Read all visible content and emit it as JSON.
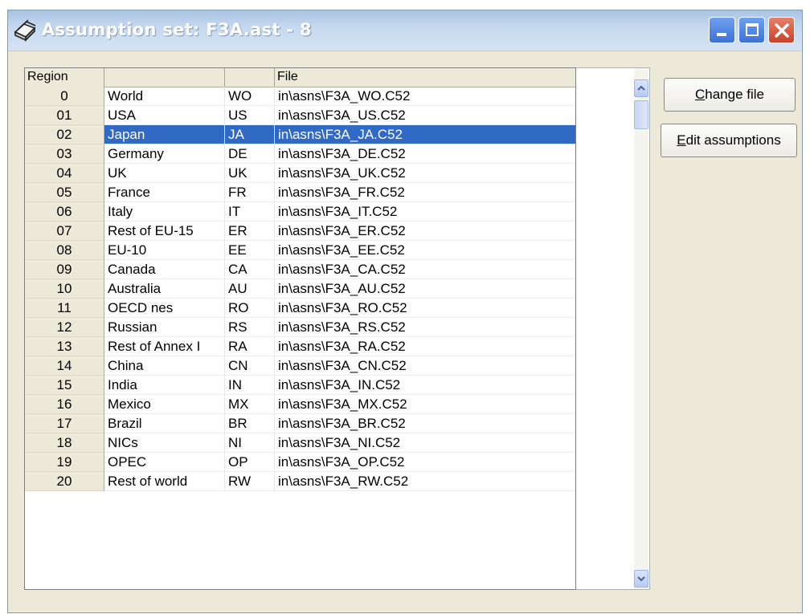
{
  "window": {
    "title": "Assumption set: F3A.ast - 8",
    "icons": {
      "app": "books-icon",
      "minimize": "minimize-icon",
      "maximize": "maximize-icon",
      "close": "close-icon"
    }
  },
  "table": {
    "headers": {
      "region": "Region",
      "name": "",
      "code": "",
      "file": "File"
    },
    "rows": [
      {
        "region": "0",
        "name": "World",
        "code": "WO",
        "file": "in\\asns\\F3A_WO.C52"
      },
      {
        "region": "01",
        "name": "USA",
        "code": "US",
        "file": "in\\asns\\F3A_US.C52"
      },
      {
        "region": "02",
        "name": "Japan",
        "code": "JA",
        "file": "in\\asns\\F3A_JA.C52"
      },
      {
        "region": "03",
        "name": "Germany",
        "code": "DE",
        "file": "in\\asns\\F3A_DE.C52"
      },
      {
        "region": "04",
        "name": "UK",
        "code": "UK",
        "file": "in\\asns\\F3A_UK.C52"
      },
      {
        "region": "05",
        "name": "France",
        "code": "FR",
        "file": "in\\asns\\F3A_FR.C52"
      },
      {
        "region": "06",
        "name": "Italy",
        "code": "IT",
        "file": "in\\asns\\F3A_IT.C52"
      },
      {
        "region": "07",
        "name": "Rest of EU-15",
        "code": "ER",
        "file": "in\\asns\\F3A_ER.C52"
      },
      {
        "region": "08",
        "name": "EU-10",
        "code": "EE",
        "file": "in\\asns\\F3A_EE.C52"
      },
      {
        "region": "09",
        "name": "Canada",
        "code": "CA",
        "file": "in\\asns\\F3A_CA.C52"
      },
      {
        "region": "10",
        "name": "Australia",
        "code": "AU",
        "file": "in\\asns\\F3A_AU.C52"
      },
      {
        "region": "11",
        "name": "OECD nes",
        "code": "RO",
        "file": "in\\asns\\F3A_RO.C52"
      },
      {
        "region": "12",
        "name": "Russian",
        "code": "RS",
        "file": "in\\asns\\F3A_RS.C52"
      },
      {
        "region": "13",
        "name": "Rest of Annex I",
        "code": "RA",
        "file": "in\\asns\\F3A_RA.C52"
      },
      {
        "region": "14",
        "name": "China",
        "code": "CN",
        "file": "in\\asns\\F3A_CN.C52"
      },
      {
        "region": "15",
        "name": "India",
        "code": "IN",
        "file": "in\\asns\\F3A_IN.C52"
      },
      {
        "region": "16",
        "name": "Mexico",
        "code": "MX",
        "file": "in\\asns\\F3A_MX.C52"
      },
      {
        "region": "17",
        "name": "Brazil",
        "code": "BR",
        "file": "in\\asns\\F3A_BR.C52"
      },
      {
        "region": "18",
        "name": "NICs",
        "code": "NI",
        "file": "in\\asns\\F3A_NI.C52"
      },
      {
        "region": "19",
        "name": "OPEC",
        "code": "OP",
        "file": "in\\asns\\F3A_OP.C52"
      },
      {
        "region": "20",
        "name": "Rest of world",
        "code": "RW",
        "file": "in\\asns\\F3A_RW.C52"
      }
    ],
    "selected_region": "02"
  },
  "buttons": {
    "change_file": {
      "mnemonic": "C",
      "rest": "hange file"
    },
    "edit_assumptions": {
      "mnemonic": "E",
      "rest": "dit assumptions"
    }
  },
  "colors": {
    "selection": "#316ac5",
    "face": "#ece9d8"
  }
}
